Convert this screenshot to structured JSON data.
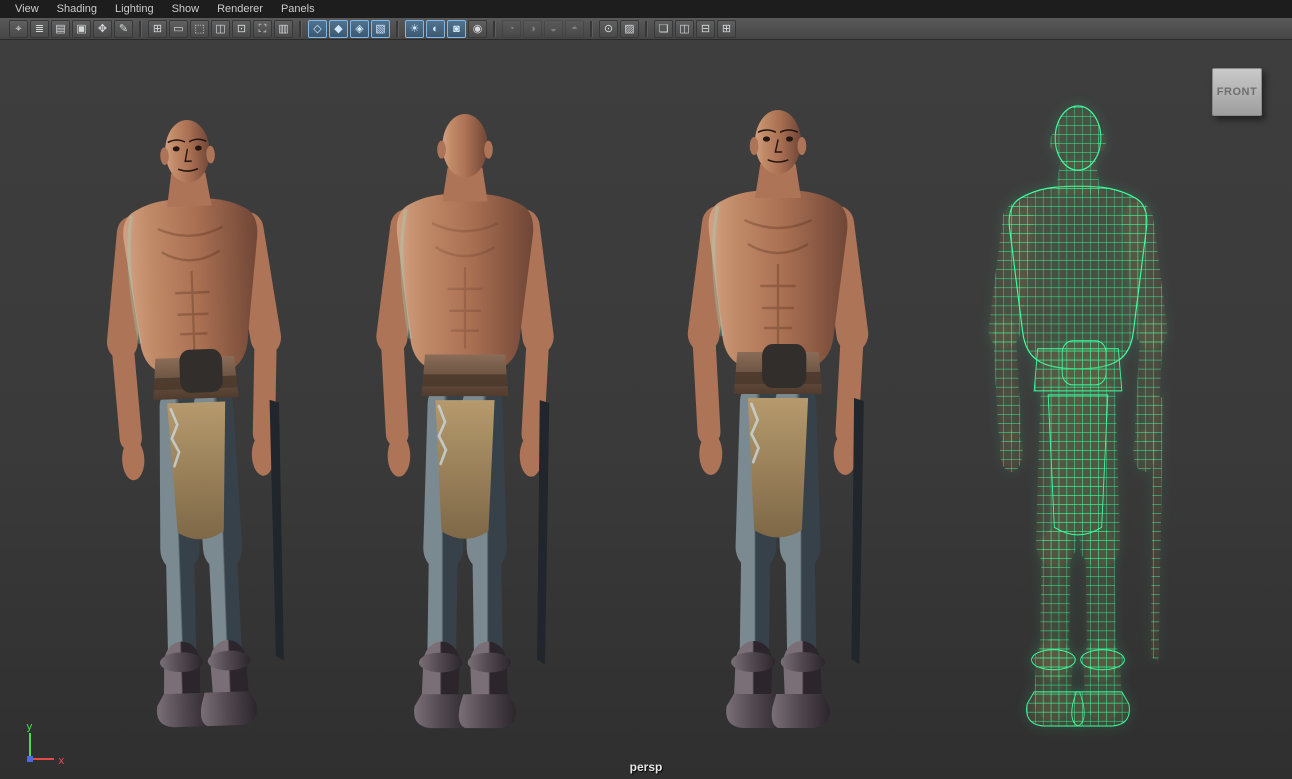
{
  "menu_bar": {
    "items": [
      {
        "label": "View"
      },
      {
        "label": "Shading"
      },
      {
        "label": "Lighting"
      },
      {
        "label": "Show"
      },
      {
        "label": "Renderer"
      },
      {
        "label": "Panels"
      }
    ]
  },
  "toolbar": {
    "groups": [
      {
        "name": "camera-tools",
        "icons": [
          {
            "name": "select-camera",
            "glyph": "⌖",
            "state": "normal"
          },
          {
            "name": "camera-attributes",
            "glyph": "≣",
            "state": "normal"
          },
          {
            "name": "bookmark-view",
            "glyph": "▤",
            "state": "normal"
          },
          {
            "name": "image-plane",
            "glyph": "▣",
            "state": "normal"
          },
          {
            "name": "two-d-pan-zoom",
            "glyph": "✥",
            "state": "normal"
          },
          {
            "name": "grease-pencil",
            "glyph": "✎",
            "state": "normal"
          }
        ]
      },
      {
        "name": "gates",
        "icons": [
          {
            "name": "grid",
            "glyph": "⊞",
            "state": "normal"
          },
          {
            "name": "film-gate",
            "glyph": "▭",
            "state": "normal"
          },
          {
            "name": "resolution-gate",
            "glyph": "⬚",
            "state": "normal"
          },
          {
            "name": "gate-mask",
            "glyph": "◫",
            "state": "normal"
          },
          {
            "name": "field-chart",
            "glyph": "⊡",
            "state": "normal"
          },
          {
            "name": "safe-action",
            "glyph": "⛶",
            "state": "normal"
          },
          {
            "name": "safe-title",
            "glyph": "▥",
            "state": "normal"
          }
        ]
      },
      {
        "name": "shading-modes",
        "icons": [
          {
            "name": "wireframe-shade",
            "glyph": "◇",
            "state": "active"
          },
          {
            "name": "smooth-shade",
            "glyph": "◆",
            "state": "active"
          },
          {
            "name": "flat-shade",
            "glyph": "◈",
            "state": "active"
          },
          {
            "name": "textured",
            "glyph": "▧",
            "state": "active"
          }
        ]
      },
      {
        "name": "lighting-fx",
        "icons": [
          {
            "name": "use-all-lights",
            "glyph": "☀",
            "state": "active"
          },
          {
            "name": "shadows",
            "glyph": "◐",
            "state": "active"
          },
          {
            "name": "screen-space-ao",
            "glyph": "◙",
            "state": "active"
          },
          {
            "name": "motion-blur",
            "glyph": "◉",
            "state": "normal"
          }
        ]
      },
      {
        "name": "display-adjust",
        "icons": [
          {
            "name": "exposure",
            "glyph": "◔",
            "state": "disabled"
          },
          {
            "name": "contrast",
            "glyph": "◑",
            "state": "disabled"
          },
          {
            "name": "gamma",
            "glyph": "◒",
            "state": "disabled"
          },
          {
            "name": "color-management",
            "glyph": "◓",
            "state": "disabled"
          }
        ]
      },
      {
        "name": "isolate",
        "icons": [
          {
            "name": "isolate-select",
            "glyph": "⊙",
            "state": "normal"
          },
          {
            "name": "xray",
            "glyph": "▨",
            "state": "normal"
          }
        ]
      },
      {
        "name": "pane-layouts",
        "icons": [
          {
            "name": "single-pane-layout",
            "glyph": "❏",
            "state": "normal"
          },
          {
            "name": "side-by-side-pane-layout",
            "glyph": "◫",
            "state": "normal"
          },
          {
            "name": "stacked-pane-layout",
            "glyph": "⊟",
            "state": "normal"
          },
          {
            "name": "quad-pane-layout",
            "glyph": "⊞",
            "state": "normal"
          }
        ]
      }
    ]
  },
  "viewport": {
    "camera_label": "persp",
    "image_plane_label": "FRONT",
    "axis_gizmo": {
      "y_label": "y",
      "x_label": "x",
      "y_color": "#4ddc4d",
      "x_color": "#e04a4a",
      "z_color": "#4a6ae0"
    },
    "models": [
      {
        "id": "three-quarter-view",
        "shading": "textured"
      },
      {
        "id": "back-view",
        "shading": "textured"
      },
      {
        "id": "front-view",
        "shading": "textured"
      },
      {
        "id": "wireframe-view",
        "shading": "wireframe-on-shaded",
        "wire_color": "#3dff9e"
      }
    ]
  },
  "colors": {
    "menu_bg": "#1d1d1d",
    "toolbar_bg": "#4d4d4d",
    "viewport_bg": "#3b3b3b",
    "active_icon_border": "#7fb7e6",
    "wireframe_green": "#3dff9e"
  }
}
